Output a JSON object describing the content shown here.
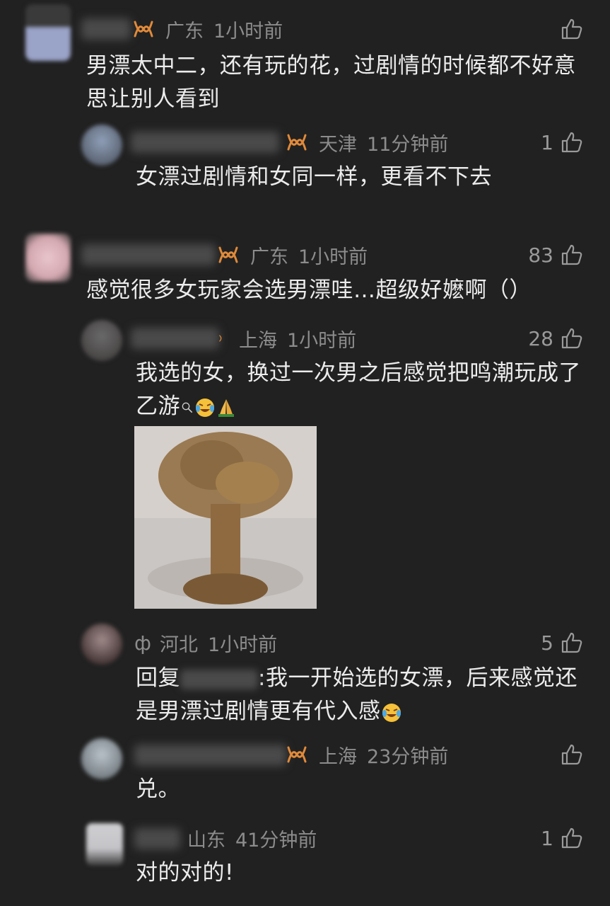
{
  "accent_color": "#e08a3a",
  "comments": [
    {
      "location": "广东",
      "time": "1小时前",
      "likes": "",
      "text": "男漂太中二，还有玩的花，过剧情的时候都不好意思让别人看到"
    },
    {
      "location": "天津",
      "time": "11分钟前",
      "likes": "1",
      "text": "女漂过剧情和女同一样，更看不下去"
    },
    {
      "location": "广东",
      "time": "1小时前",
      "likes": "83",
      "text": "感觉很多女玩家会选男漂哇…超级好嬷啊（）"
    },
    {
      "location": "上海",
      "time": "1小时前",
      "likes": "28",
      "text_line1": "我选的女，换过一次男之后感觉把鸣潮玩成了",
      "text_line2": "乙游"
    },
    {
      "location": "河北",
      "time": "1小时前",
      "likes": "5",
      "reply_prefix": "回复",
      "text_line1": ":我一开始选的女漂，后来感觉还",
      "text_line2": "是男漂过剧情更有代入感"
    },
    {
      "location": "上海",
      "time": "23分钟前",
      "likes": "",
      "text": "兑。"
    },
    {
      "location": "山东",
      "time": "41分钟前",
      "likes": "1",
      "text": "对的对的!"
    }
  ],
  "icons": {
    "like": "thumb-up-icon",
    "badge": "vip-badge-icon"
  }
}
